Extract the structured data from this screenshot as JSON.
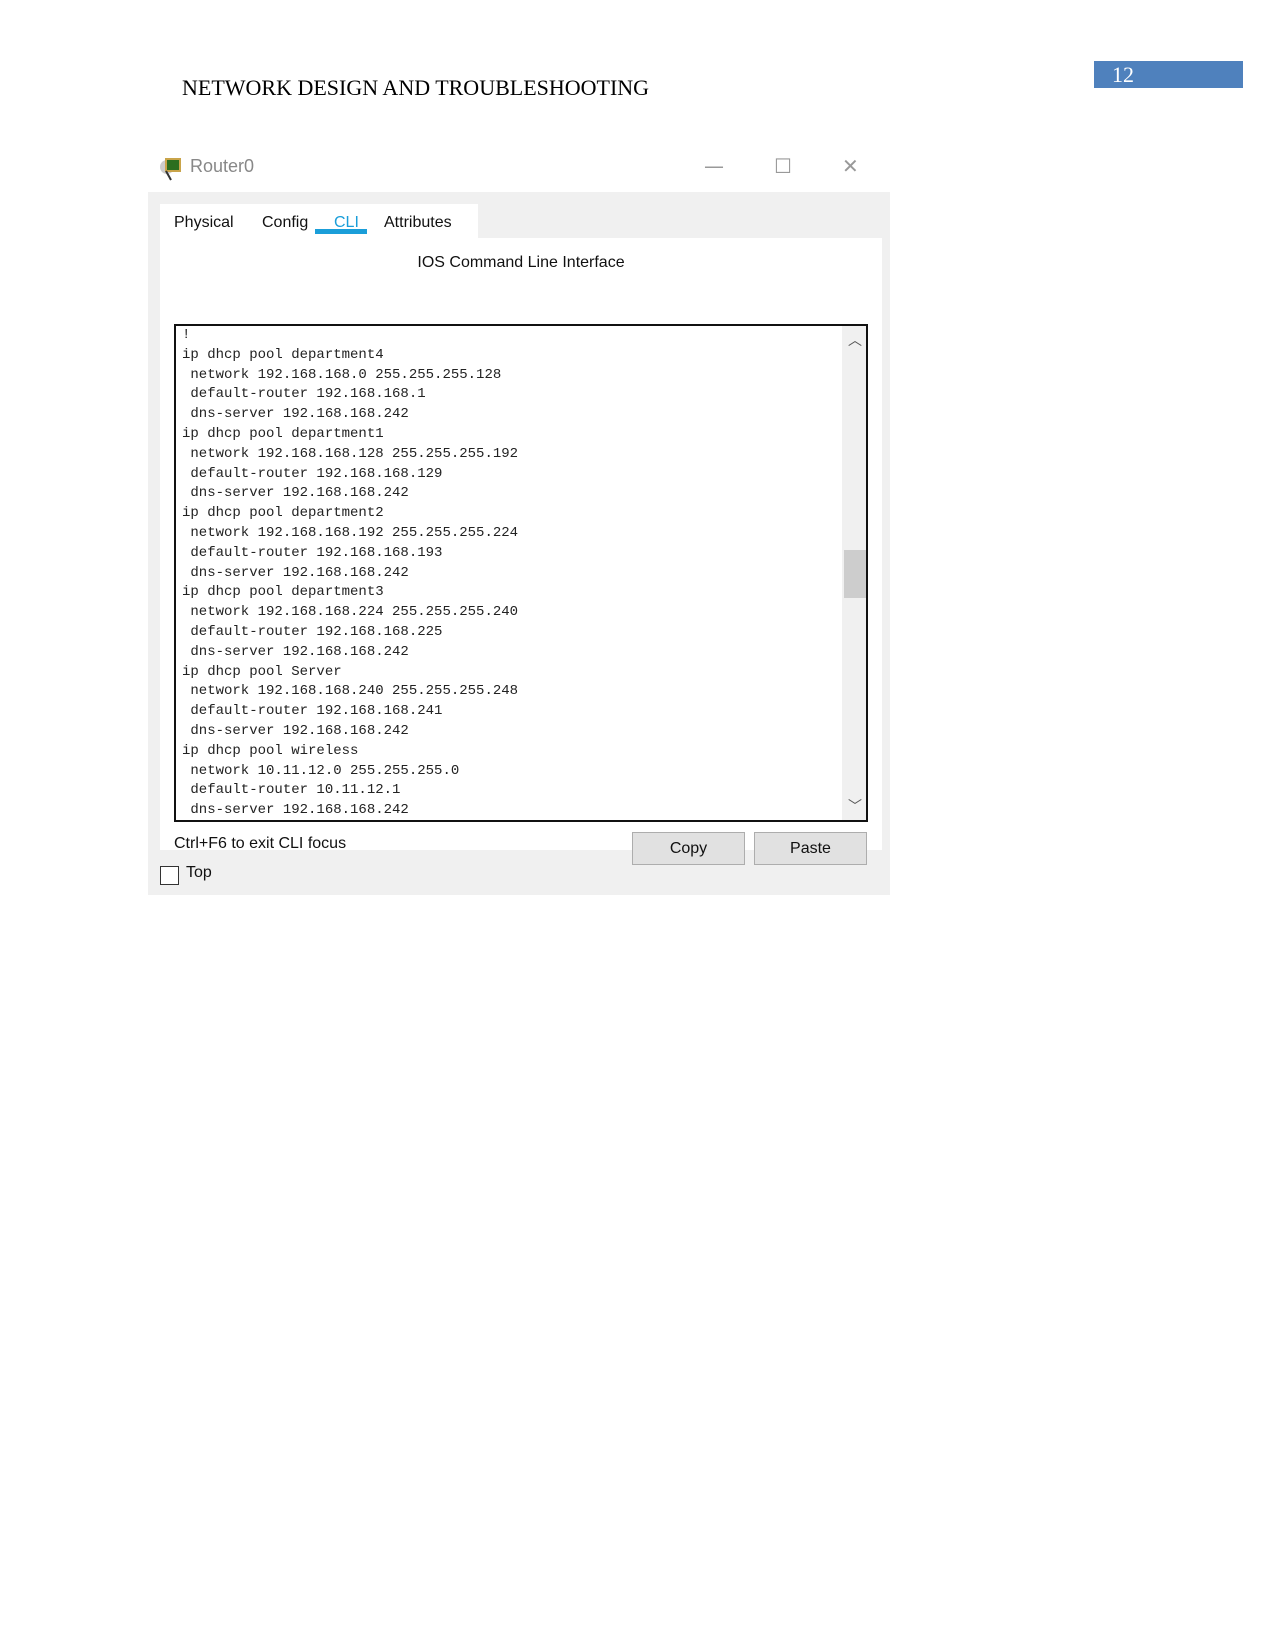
{
  "header": {
    "title": "NETWORK DESIGN AND TROUBLESHOOTING",
    "page_number": "12"
  },
  "window": {
    "title": "Router0",
    "icon": "router-icon",
    "tabs": [
      {
        "label": "Physical"
      },
      {
        "label": "Config"
      },
      {
        "label": "CLI",
        "active": true
      },
      {
        "label": "Attributes"
      }
    ],
    "panel_title": "IOS Command Line Interface",
    "cli_lines": [
      "!",
      "ip dhcp pool department4",
      " network 192.168.168.0 255.255.255.128",
      " default-router 192.168.168.1",
      " dns-server 192.168.168.242",
      "ip dhcp pool department1",
      " network 192.168.168.128 255.255.255.192",
      " default-router 192.168.168.129",
      " dns-server 192.168.168.242",
      "ip dhcp pool department2",
      " network 192.168.168.192 255.255.255.224",
      " default-router 192.168.168.193",
      " dns-server 192.168.168.242",
      "ip dhcp pool department3",
      " network 192.168.168.224 255.255.255.240",
      " default-router 192.168.168.225",
      " dns-server 192.168.168.242",
      "ip dhcp pool Server",
      " network 192.168.168.240 255.255.255.248",
      " default-router 192.168.168.241",
      " dns-server 192.168.168.242",
      "ip dhcp pool wireless",
      " network 10.11.12.0 255.255.255.0",
      " default-router 10.11.12.1",
      " dns-server 192.168.168.242"
    ],
    "hint": "Ctrl+F6 to exit CLI focus",
    "copy_label": "Copy",
    "paste_label": "Paste",
    "top_label": "Top",
    "top_checked": false,
    "accent": "#1a9ed9"
  }
}
